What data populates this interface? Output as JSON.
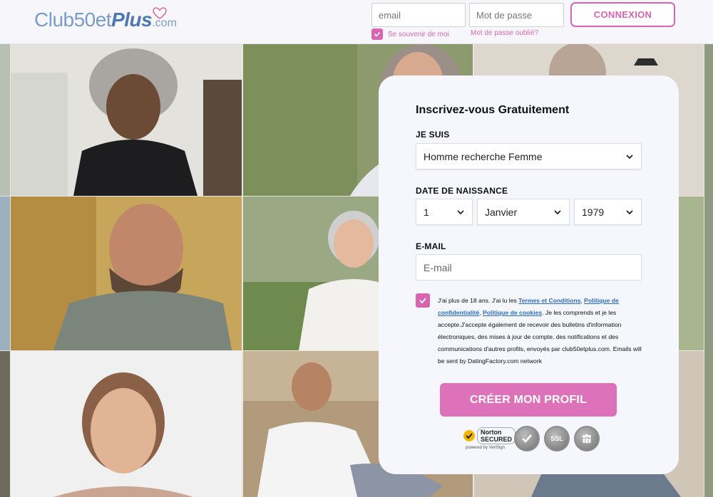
{
  "header": {
    "logo": {
      "main": "Club50et",
      "plus": "Plus",
      "com": ".com"
    },
    "email_placeholder": "email",
    "password_placeholder": "Mot de passe",
    "login_button": "CONNEXION",
    "remember_me": "Se souvenir de moi",
    "forgot_password": "Mot de passe oublié?"
  },
  "signup": {
    "title": "Inscrivez-vous Gratuitement",
    "i_am_label": "JE SUIS",
    "i_am_value": "Homme recherche Femme",
    "birth_label": "DATE DE NAISSANCE",
    "day_value": "1",
    "month_value": "Janvier",
    "year_value": "1979",
    "email_label": "E-MAIL",
    "email_placeholder": "E-mail",
    "terms": {
      "t1": "J'ai plus de 18 ans. J'ai lu les ",
      "link_terms": "Termes et Conditions",
      "t2": ", ",
      "link_privacy": "Politique de confidentialité",
      "t3": ", ",
      "link_cookies": "Politique de cookies",
      "t4": ". Je les comprends et je les accepte.J'accepte également de recevoir des bulletins d'information électroniques, des mises à jour de compte, des notifications et des communications d'autres profils, envoyés par club50etplus.com. Emails will be sent by DatingFactory.com network"
    },
    "create_button": "CRÉER MON PROFIL",
    "badges": {
      "norton_name": "Norton",
      "norton_secured": "SECURED",
      "norton_powered": "powered by VeriSign",
      "ssl": "SSL"
    }
  },
  "colors": {
    "accent": "#d965b0",
    "button": "#dd72bb",
    "logo_blue": "#4d78b3",
    "link": "#2a6cc4"
  }
}
